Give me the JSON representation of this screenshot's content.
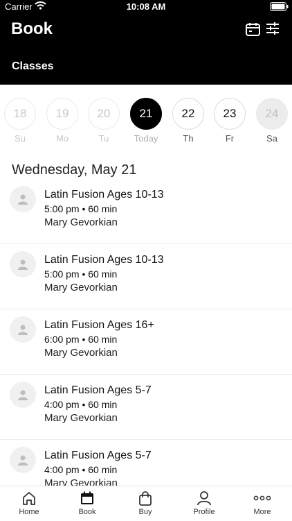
{
  "status_bar": {
    "carrier": "Carrier",
    "time": "10:08 AM"
  },
  "header": {
    "title": "Book",
    "subtitle": "Classes"
  },
  "days": [
    {
      "num": "18",
      "label": "Su",
      "state": "past"
    },
    {
      "num": "19",
      "label": "Mo",
      "state": "past"
    },
    {
      "num": "20",
      "label": "Tu",
      "state": "past"
    },
    {
      "num": "21",
      "label": "Today",
      "state": "today"
    },
    {
      "num": "22",
      "label": "Th",
      "state": "future"
    },
    {
      "num": "23",
      "label": "Fr",
      "state": "future"
    },
    {
      "num": "24",
      "label": "Sa",
      "state": "dim"
    }
  ],
  "date_heading": "Wednesday, May 21",
  "classes": [
    {
      "name": "Latin Fusion Ages 10-13",
      "time": "5:00 pm • 60 min",
      "instructor": "Mary Gevorkian"
    },
    {
      "name": "Latin Fusion Ages 10-13",
      "time": "5:00 pm • 60 min",
      "instructor": "Mary Gevorkian"
    },
    {
      "name": "Latin Fusion Ages 16+",
      "time": "6:00 pm • 60 min",
      "instructor": "Mary Gevorkian"
    },
    {
      "name": "Latin Fusion Ages 5-7",
      "time": "4:00 pm • 60 min",
      "instructor": "Mary Gevorkian"
    },
    {
      "name": "Latin Fusion Ages 5-7",
      "time": "4:00 pm • 60 min",
      "instructor": "Mary Gevorkian"
    }
  ],
  "tabbar": {
    "home": "Home",
    "book": "Book",
    "buy": "Buy",
    "profile": "Profile",
    "more": "More"
  }
}
